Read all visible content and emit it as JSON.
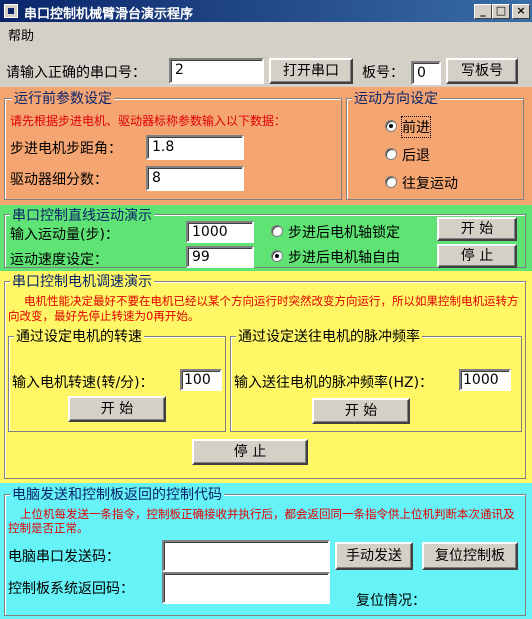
{
  "window": {
    "title": "串口控制机械臂滑台演示程序",
    "min": "_",
    "max": "□",
    "close": "×"
  },
  "menu": {
    "help": "帮助"
  },
  "top": {
    "port_label": "请输入正确的串口号：",
    "port_value": "2",
    "open_port": "打开串口",
    "board_label": "板号：",
    "board_value": "0",
    "write_board": "写板号"
  },
  "params": {
    "title": "运行前参数设定",
    "hint": "请先根据步进电机、驱动器标称参数输入以下数据：",
    "step_angle_label": "步进电机步距角：",
    "step_angle_value": "1.8",
    "microstep_label": "驱动器细分数：",
    "microstep_value": "8"
  },
  "direction": {
    "title": "运动方向设定",
    "forward": "前进",
    "backward": "后退",
    "reciprocate": "往复运动",
    "selected": "forward"
  },
  "linear": {
    "title": "串口控制直线运动演示",
    "amount_label": "输入运动量(步)：",
    "amount_value": "1000",
    "speed_label": "运动速度设定：",
    "speed_value": "99",
    "lock": "步进后电机轴锁定",
    "free": "步进后电机轴自由",
    "selected": "free",
    "start": "开  始",
    "stop": "停  止"
  },
  "speed": {
    "title": "串口控制电机调速演示",
    "warning": "电机性能决定最好不要在电机已经以某个方向运行时突然改变方向运行，所以如果控制电机运转方向改变，最好先停止转速为0再开始。",
    "rpm_title": "通过设定电机的转速",
    "rpm_label": "输入电机转速(转/分)：",
    "rpm_value": "100",
    "rpm_start": "开  始",
    "freq_title": "通过设定送往电机的脉冲频率",
    "freq_label": "输入送往电机的脉冲频率(HZ)：",
    "freq_value": "1000",
    "freq_start": "开  始",
    "stop": "停  止"
  },
  "codes": {
    "title": "电脑发送和控制板返回的控制代码",
    "note": "上位机每发送一条指令，控制板正确接收并执行后，都会返回同一条指令供上位机判断本次通讯及控制是否正常。",
    "send_label": "电脑串口发送码：",
    "send_value": "",
    "return_label": "控制板系统返回码：",
    "return_value": "",
    "manual_send": "手动发送",
    "reset_board": "复位控制板",
    "reset_status_label": "复位情况："
  },
  "colors": {
    "orange": "#f4a572",
    "green": "#5ee374",
    "yellow": "#fff766",
    "cyan": "#66f3f8",
    "title_blue": "#0a246a",
    "title_red": "#e00000"
  }
}
